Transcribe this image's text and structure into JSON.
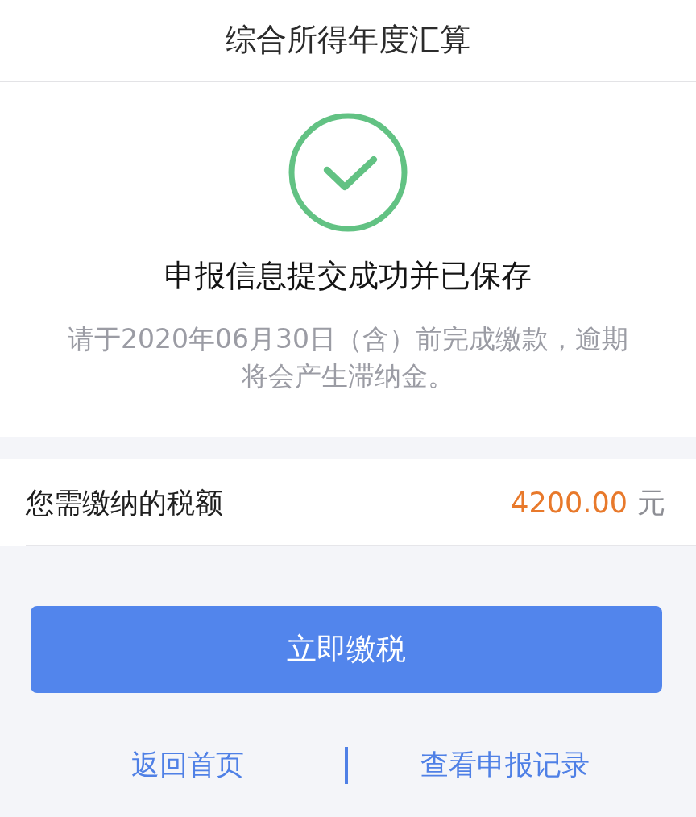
{
  "header": {
    "title": "综合所得年度汇算"
  },
  "result": {
    "kind": "success",
    "heading": "申报信息提交成功并已保存",
    "notice": "请于2020年06月30日（含）前完成缴款，逾期将会产生滞纳金。"
  },
  "tax_due": {
    "label": "您需缴纳的税额",
    "amount": "4200.00",
    "unit": "元"
  },
  "primary_button": {
    "label": "立即缴税"
  },
  "links": [
    "返回首页",
    "查看申报记录"
  ]
}
